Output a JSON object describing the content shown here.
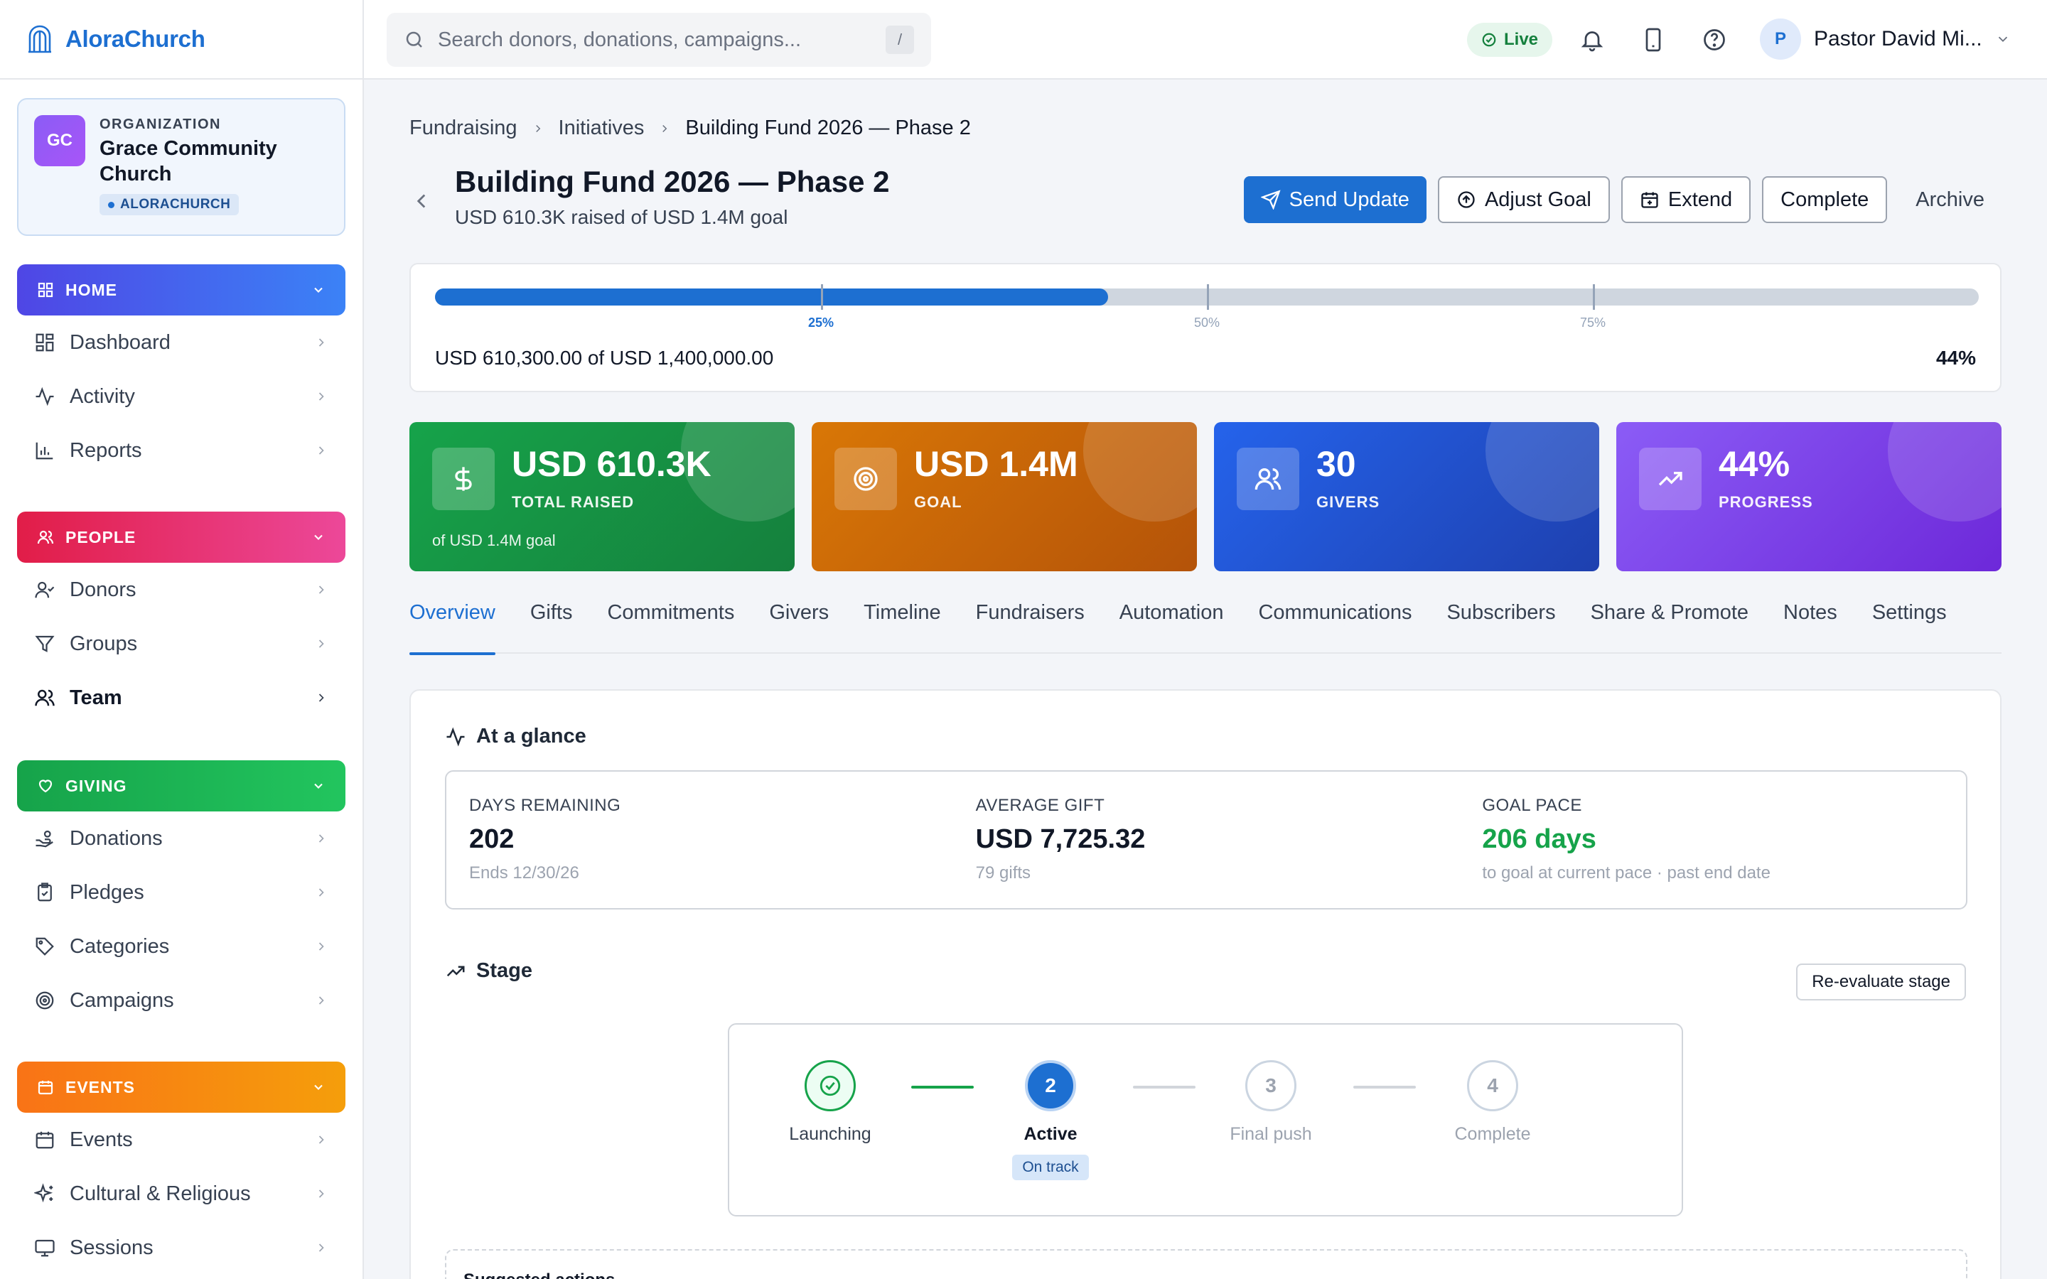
{
  "app": {
    "name": "AloraChurch"
  },
  "org": {
    "kicker": "ORGANIZATION",
    "name": "Grace Community Church",
    "initials": "GC",
    "badge": "ALORACHURCH"
  },
  "sidebar": {
    "groups": [
      {
        "label": "HOME",
        "color": "#4f46e5",
        "items": [
          {
            "label": "Dashboard"
          },
          {
            "label": "Activity"
          },
          {
            "label": "Reports"
          }
        ]
      },
      {
        "label": "PEOPLE",
        "color": "#e11d48",
        "items": [
          {
            "label": "Donors"
          },
          {
            "label": "Groups"
          },
          {
            "label": "Team"
          }
        ]
      },
      {
        "label": "GIVING",
        "color": "#16a34a",
        "items": [
          {
            "label": "Donations"
          },
          {
            "label": "Pledges"
          },
          {
            "label": "Categories"
          },
          {
            "label": "Campaigns"
          }
        ]
      },
      {
        "label": "EVENTS",
        "color": "#f97316",
        "items": [
          {
            "label": "Events"
          },
          {
            "label": "Cultural & Religious"
          },
          {
            "label": "Sessions"
          }
        ]
      }
    ]
  },
  "topbar": {
    "search_placeholder": "Search donors, donations, campaigns...",
    "search_shortcut": "/",
    "live_label": "Live",
    "user_initial": "P",
    "user_name": "Pastor David Mi..."
  },
  "breadcrumb": [
    "Fundraising",
    "Initiatives",
    "Building Fund 2026 — Phase 2"
  ],
  "page": {
    "title": "Building Fund 2026 — Phase 2",
    "subtitle": "USD 610.3K raised of USD 1.4M goal",
    "actions": {
      "send_update": "Send Update",
      "adjust_goal": "Adjust Goal",
      "extend": "Extend",
      "complete": "Complete",
      "archive": "Archive"
    }
  },
  "progress": {
    "fraction": 0.436,
    "milestones": [
      "25%",
      "50%",
      "75%"
    ],
    "text": "USD 610,300.00 of USD 1,400,000.00",
    "percent_label": "44%"
  },
  "stats": [
    {
      "value": "USD 610.3K",
      "label": "TOTAL RAISED",
      "foot": "of USD 1.4M goal",
      "icon": "dollar-icon"
    },
    {
      "value": "USD 1.4M",
      "label": "GOAL",
      "foot": "",
      "icon": "target-icon"
    },
    {
      "value": "30",
      "label": "GIVERS",
      "foot": "",
      "icon": "users-icon"
    },
    {
      "value": "44%",
      "label": "PROGRESS",
      "foot": "",
      "icon": "trending-up-icon"
    }
  ],
  "colors": {
    "primary": "#1d6fd1",
    "success": "#16a34a"
  },
  "tabs": [
    "Overview",
    "Gifts",
    "Commitments",
    "Givers",
    "Timeline",
    "Fundraisers",
    "Automation",
    "Communications",
    "Subscribers",
    "Share & Promote",
    "Notes",
    "Settings"
  ],
  "glance": {
    "title": "At a glance",
    "days_remaining": {
      "label": "DAYS REMAINING",
      "value": "202",
      "sub": "Ends 12/30/26"
    },
    "average_gift": {
      "label": "AVERAGE GIFT",
      "value": "USD 7,725.32",
      "sub": "79 gifts"
    },
    "goal_pace": {
      "label": "GOAL PACE",
      "value": "206 days",
      "sub": "to goal at current pace · past end date"
    }
  },
  "stage": {
    "title": "Stage",
    "reevaluate": "Re-evaluate stage",
    "steps": [
      {
        "number": "1",
        "name": "Launching",
        "state": "done"
      },
      {
        "number": "2",
        "name": "Active",
        "state": "current",
        "chip": "On track"
      },
      {
        "number": "3",
        "name": "Final push",
        "state": "todo"
      },
      {
        "number": "4",
        "name": "Complete",
        "state": "todo"
      }
    ]
  },
  "suggested": {
    "title": "Suggested actions"
  }
}
